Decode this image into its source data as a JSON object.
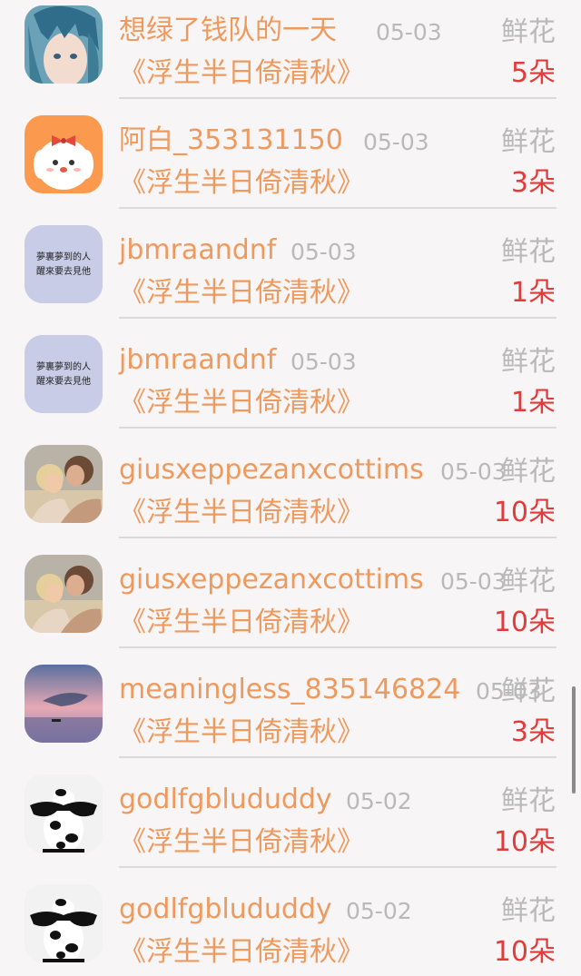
{
  "gift_list": {
    "items": [
      {
        "avatar": "anime-boy-avatar",
        "name": "想绿了钱队的一天",
        "date": "05-03",
        "gift_type": "鲜花",
        "book": "《浮生半日倚清秋》",
        "count": "5朵"
      },
      {
        "avatar": "white-dog-bow-avatar",
        "name": "阿白_353131150",
        "date": "05-03",
        "gift_type": "鲜花",
        "book": "《浮生半日倚清秋》",
        "count": "3朵"
      },
      {
        "avatar": "text-calligraphy-avatar",
        "avatar_text": [
          "夢裏夢到的人",
          "醒來要去見他"
        ],
        "name": "jbmraandnf",
        "date": "05-03",
        "gift_type": "鲜花",
        "book": "《浮生半日倚清秋》",
        "count": "1朵"
      },
      {
        "avatar": "text-calligraphy-avatar",
        "avatar_text": [
          "夢裏夢到的人",
          "醒來要去見他"
        ],
        "name": "jbmraandnf",
        "date": "05-03",
        "gift_type": "鲜花",
        "book": "《浮生半日倚清秋》",
        "count": "1朵"
      },
      {
        "avatar": "couple-photo-avatar",
        "name": "giusxeppezanxcottims",
        "date": "05-03",
        "gift_type": "鲜花",
        "book": "《浮生半日倚清秋》",
        "count": "10朵"
      },
      {
        "avatar": "couple-photo-avatar",
        "name": "giusxeppezanxcottims",
        "date": "05-03",
        "gift_type": "鲜花",
        "book": "《浮生半日倚清秋》",
        "count": "10朵"
      },
      {
        "avatar": "whale-sky-avatar",
        "name": "meaningless_835146824",
        "date": "05-03",
        "gift_type": "鲜花",
        "book": "《浮生半日倚清秋》",
        "count": "3朵"
      },
      {
        "avatar": "cow-sunglasses-avatar",
        "name": "godlfgblududdy",
        "date": "05-02",
        "gift_type": "鲜花",
        "book": "《浮生半日倚清秋》",
        "count": "10朵"
      },
      {
        "avatar": "cow-sunglasses-avatar",
        "name": "godlfgblududdy",
        "date": "05-02",
        "gift_type": "鲜花",
        "book": "《浮生半日倚清秋》",
        "count": "10朵"
      }
    ]
  },
  "colors": {
    "name": "#ee9a5f",
    "count": "#e23b3b",
    "muted": "#b9b9b9",
    "divider": "#dadada",
    "background": "#f7f5f5"
  }
}
